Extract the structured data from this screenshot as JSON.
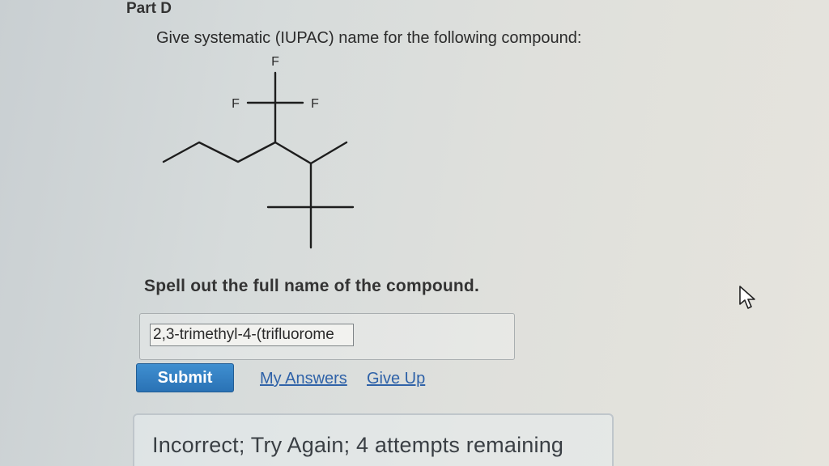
{
  "part": {
    "title": "Part D"
  },
  "question": {
    "text": "Give systematic (IUPAC) name for the following compound:"
  },
  "molecule": {
    "atom_labels": {
      "top": "F",
      "left": "F",
      "right": "F"
    }
  },
  "instruction": {
    "text": "Spell out the full name of the compound."
  },
  "answer": {
    "value": "2,3-trimethyl-4-(trifluorome",
    "submit_label": "Submit",
    "my_answers_label": "My Answers",
    "give_up_label": "Give Up"
  },
  "feedback": {
    "text": "Incorrect; Try Again; 4 attempts remaining"
  },
  "colors": {
    "accent": "#2a72b5",
    "link": "#2f62a8",
    "text": "#2b2b2b"
  },
  "icons": {
    "cursor": "mouse-pointer-icon"
  }
}
